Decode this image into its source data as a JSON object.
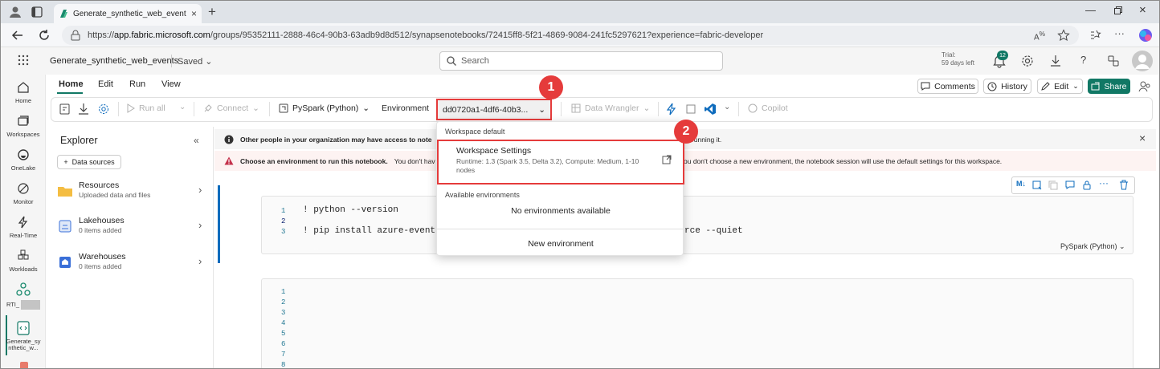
{
  "browser": {
    "tab_title": "Generate_synthetic_web_events -",
    "url_prefix": "https://",
    "url_host": "app.fabric.microsoft.com",
    "url_path": "/groups/95352111-2888-46c4-90b3-63adb9d8d512/synapsenotebooks/72415ff8-5f21-4869-9084-241fc5297621?experience=fabric-developer"
  },
  "app": {
    "notebook_name": "Generate_synthetic_web_events",
    "save_status": "Saved",
    "search_placeholder": "Search",
    "trial_line1": "Trial:",
    "trial_line2": "59 days left",
    "notification_count": "12"
  },
  "rail": {
    "items": [
      {
        "label": "Home"
      },
      {
        "label": "Workspaces"
      },
      {
        "label": "OneLake"
      },
      {
        "label": "Monitor"
      },
      {
        "label": "Real-Time"
      },
      {
        "label": "Workloads"
      },
      {
        "label": "RTI_"
      },
      {
        "label": "Generate_sy nthetic_w..."
      }
    ]
  },
  "ribbon": {
    "tabs": [
      "Home",
      "Edit",
      "Run",
      "View"
    ],
    "comments": "Comments",
    "history": "History",
    "edit": "Edit",
    "share": "Share"
  },
  "toolbar": {
    "run_all": "Run all",
    "connect": "Connect",
    "language": "PySpark (Python)",
    "environment_label": "Environment",
    "environment_value": "dd0720a1-4df6-40b3...",
    "data_wrangler": "Data Wrangler",
    "copilot": "Copilot"
  },
  "explorer": {
    "title": "Explorer",
    "add_data_sources": "Data sources",
    "items": [
      {
        "name": "Resources",
        "sub": "Uploaded data and files"
      },
      {
        "name": "Lakehouses",
        "sub": "0 items added"
      },
      {
        "name": "Warehouses",
        "sub": "0 items added"
      }
    ]
  },
  "banners": {
    "info_bold": "Other people in your organization may have access to note",
    "info_tail": "re running it.",
    "warn_bold": "Choose an environment to run this notebook.",
    "warn_mid": "You don't hav",
    "warn_tail": "ou don't choose a new environment, the notebook session will use the default settings for this workspace."
  },
  "cell1": {
    "lines": [
      "1",
      "2",
      "3"
    ],
    "code1": "! python --version",
    "code3a": "! pip install azure-eventhub",
    "code3b": "rce --quiet",
    "lang": "PySpark (Python)",
    "toolbar_md": "M↓"
  },
  "cell2": {
    "lines": [
      "1",
      "2",
      "3",
      "4",
      "5",
      "6",
      "7",
      "8"
    ]
  },
  "dropdown": {
    "section_default": "Workspace default",
    "ws_title": "Workspace Settings",
    "ws_desc": "Runtime: 1.3 (Spark 3.5, Delta 3.2), Compute: Medium, 1-10 nodes",
    "section_available": "Available environments",
    "none_available": "No environments available",
    "new_env": "New environment"
  },
  "callouts": {
    "one": "1",
    "two": "2"
  },
  "colors": {
    "accent_green": "#117865",
    "callout_red": "#e53b3b",
    "link_blue": "#0f6cbd"
  }
}
